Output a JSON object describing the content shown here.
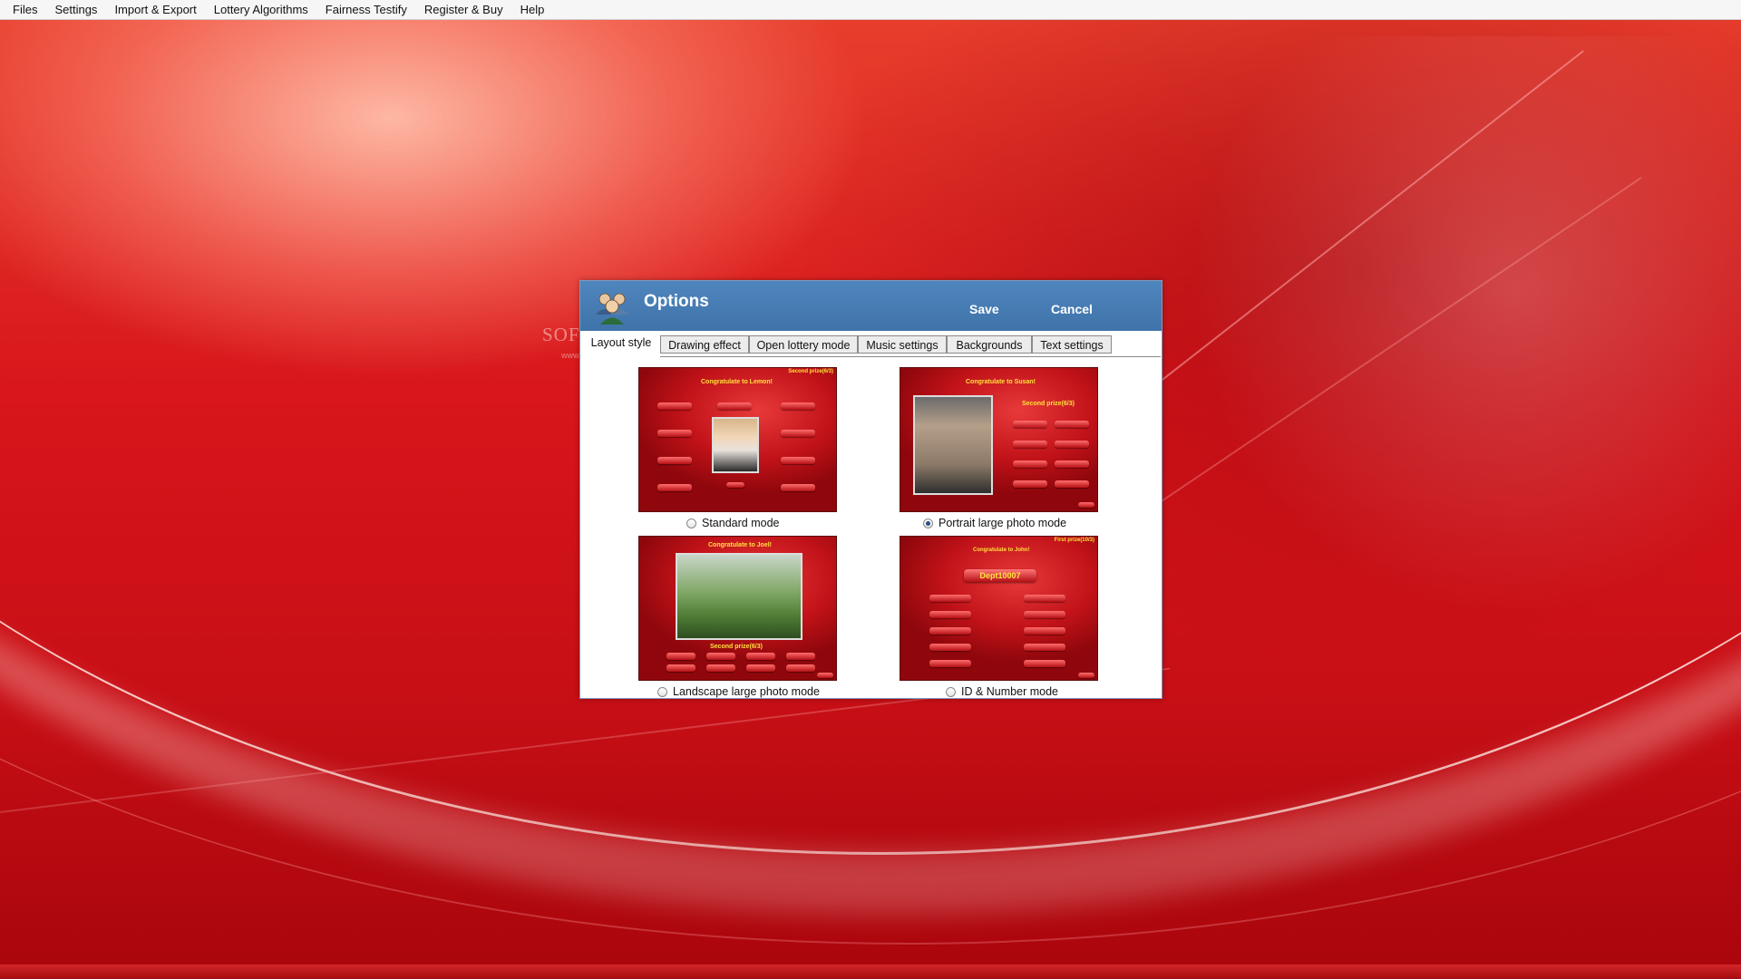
{
  "menubar": {
    "items": [
      "Files",
      "Settings",
      "Import & Export",
      "Lottery Algorithms",
      "Fairness Testify",
      "Register & Buy",
      "Help"
    ]
  },
  "watermark": {
    "text": "SOFTPEDIA",
    "url_text": "www.softpedia.com"
  },
  "dialog": {
    "title": "Options",
    "icon": "users-group-icon",
    "save_label": "Save",
    "cancel_label": "Cancel",
    "tabs": [
      {
        "label": "Layout style",
        "active": true
      },
      {
        "label": "Drawing effect",
        "active": false
      },
      {
        "label": "Open lottery mode",
        "active": false
      },
      {
        "label": "Music settings",
        "active": false
      },
      {
        "label": "Backgrounds",
        "active": false
      },
      {
        "label": "Text settings",
        "active": false
      }
    ],
    "layout_options": [
      {
        "label": "Standard mode",
        "selected": false,
        "preview": {
          "banner": "Congratulate to Lemon!",
          "prize": "Second prize(6/3)"
        }
      },
      {
        "label": "Portrait large photo mode",
        "selected": true,
        "preview": {
          "banner": "Congratulate to Susan!",
          "prize": "Second prize(6/3)"
        }
      },
      {
        "label": "Landscape large photo mode",
        "selected": false,
        "preview": {
          "banner": "Congratulate to Joel!",
          "prize": "Second prize(6/3)"
        }
      },
      {
        "label": "ID & Number mode",
        "selected": false,
        "preview": {
          "banner": "Congratulate to John!",
          "prize": "First prize(10/3)",
          "id": "Dept10007"
        }
      }
    ]
  },
  "colors": {
    "header": "#4a7fb5",
    "accent_yellow": "#ffe23a",
    "background_red": "#d0141a"
  }
}
